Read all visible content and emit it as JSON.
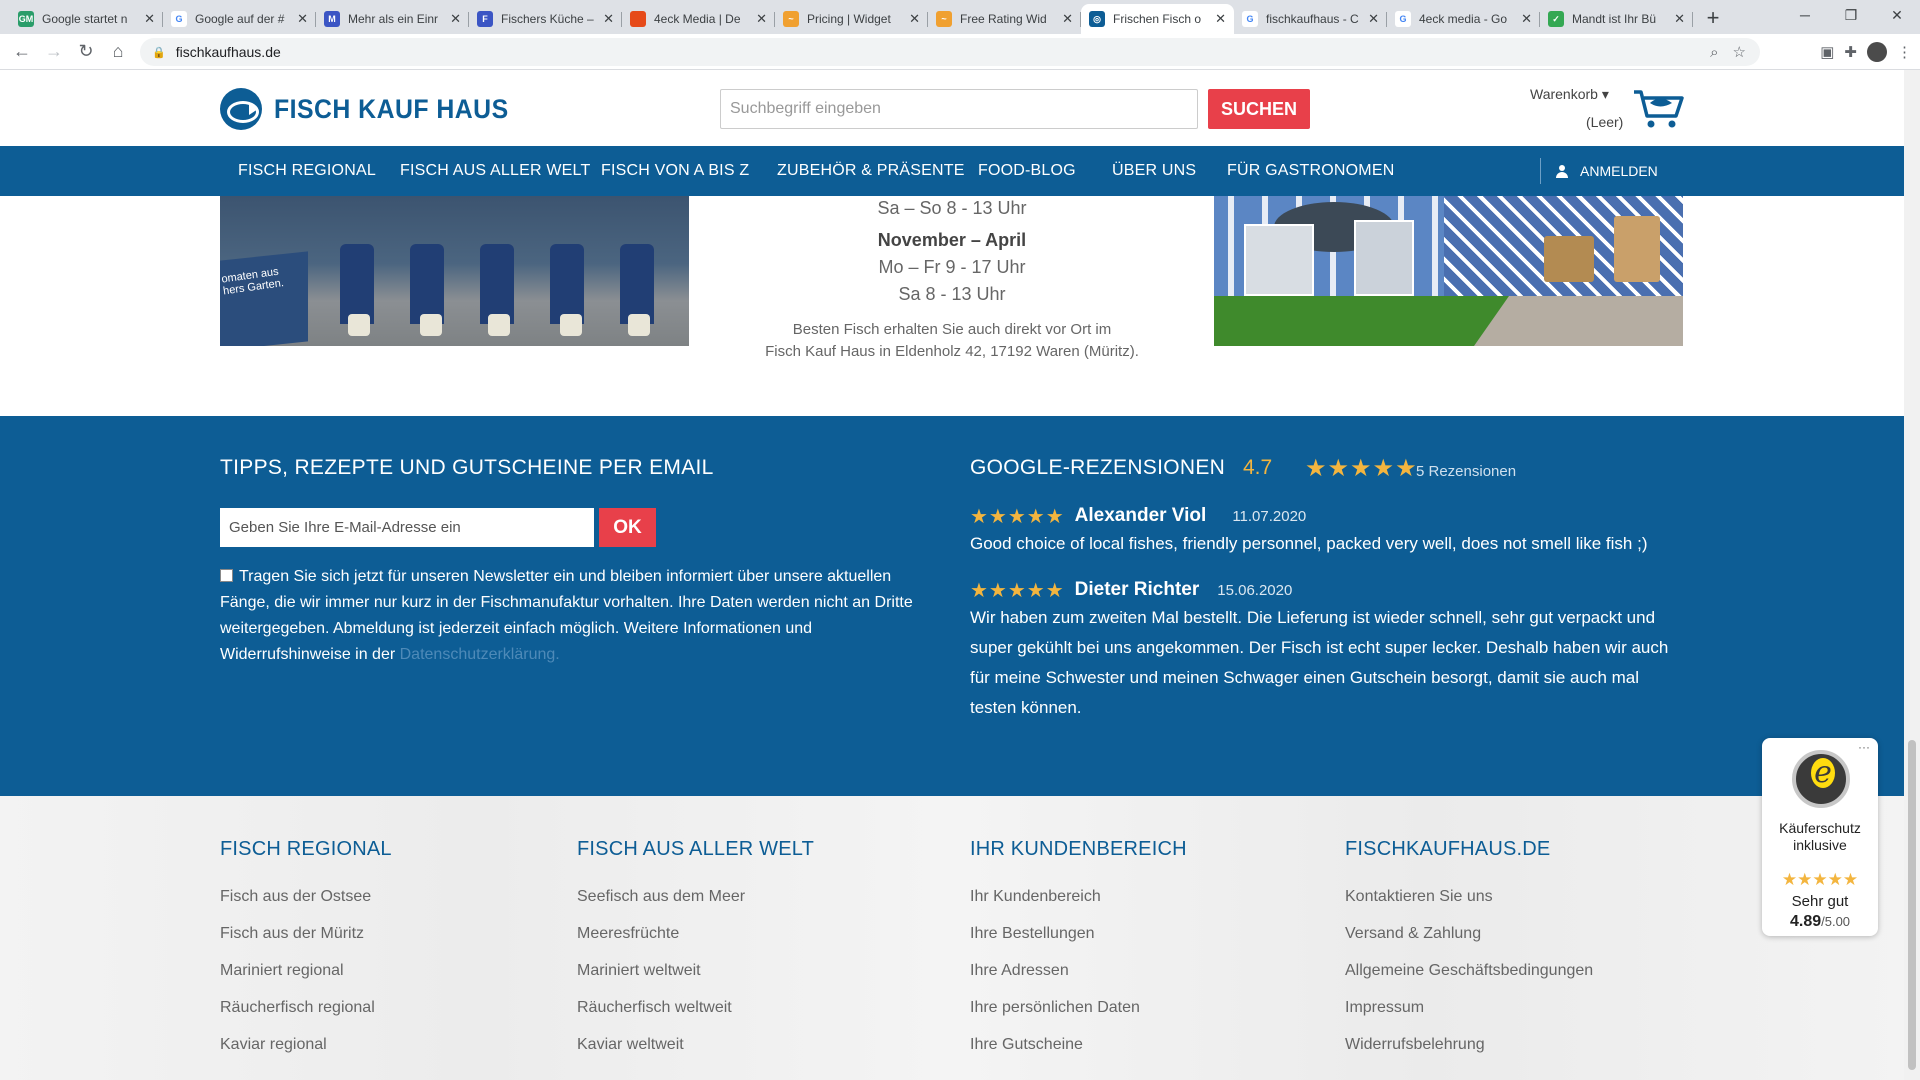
{
  "browser": {
    "tabs": [
      {
        "title": "Google startet n",
        "fav_color": "#2a9d6a",
        "fav_glyph": "GM"
      },
      {
        "title": "Google auf der #",
        "fav_color": "#ffffff",
        "fav_glyph": "G"
      },
      {
        "title": "Mehr als ein Einr",
        "fav_color": "#3b55c4",
        "fav_glyph": "M"
      },
      {
        "title": "Fischers Küche –",
        "fav_color": "#3b55c4",
        "fav_glyph": "F"
      },
      {
        "title": "4eck Media | De",
        "fav_color": "#e64a19",
        "fav_glyph": ""
      },
      {
        "title": "Pricing | Widget",
        "fav_color": "#f0a030",
        "fav_glyph": "~"
      },
      {
        "title": "Free Rating Wid",
        "fav_color": "#f0a030",
        "fav_glyph": "~"
      },
      {
        "title": "Frischen Fisch o",
        "fav_color": "#0d5d95",
        "fav_glyph": "◎"
      },
      {
        "title": "fischkaufhaus - C",
        "fav_color": "#ffffff",
        "fav_glyph": "G"
      },
      {
        "title": "4eck media - Go",
        "fav_color": "#ffffff",
        "fav_glyph": "G"
      },
      {
        "title": "Mandt ist Ihr Bü",
        "fav_color": "#34a853",
        "fav_glyph": "✓"
      }
    ],
    "active_tab": 7,
    "new_tab": "+",
    "url": "fischkaufhaus.de"
  },
  "header": {
    "logo_text": "FISCH KAUF HAUS",
    "search_placeholder": "Suchbegriff eingeben",
    "search_button": "SUCHEN",
    "cart_label": "Warenkorb ▾",
    "cart_status": "(Leer)"
  },
  "nav": {
    "items": [
      "FISCH REGIONAL",
      "FISCH AUS ALLER WELT",
      "FISCH VON A BIS Z",
      "ZUBEHÖR & PRÄSENTE",
      "FOOD-BLOG",
      "ÜBER UNS",
      "FÜR GASTRONOMEN"
    ],
    "login": "ANMELDEN"
  },
  "hours": {
    "line_top": "Sa – So   8 - 13 Uhr",
    "season": "November – April",
    "line_weekdays": "Mo – Fr   9 - 17 Uhr",
    "line_sat": "Sa   8 - 13 Uhr",
    "note_1": "Besten Fisch erhalten Sie auch direkt vor Ort im",
    "note_2": "Fisch Kauf Haus in Eldenholz 42,  17192 Waren (Müritz)."
  },
  "photo_left_sign": "omaten aus hers Garten.",
  "newsletter": {
    "title": "TIPPS, REZEPTE UND GUTSCHEINE PER EMAIL",
    "email_placeholder": "Geben Sie Ihre E-Mail-Adresse ein",
    "ok_button": "OK",
    "consent_text": "Tragen Sie sich jetzt für unseren Newsletter ein und bleiben informiert über unsere aktuellen Fänge, die wir immer nur kurz in der Fischmanufaktur vorhalten. Ihre Daten werden nicht an Dritte weitergegeben. Abmeldung ist jederzeit einfach möglich. Weitere Informationen und Widerrufshinweise in der ",
    "consent_link": "Datenschutzerklärung."
  },
  "google_reviews": {
    "title": "GOOGLE-REZENSIONEN",
    "rating": "4.7",
    "stars": "★★★★★",
    "count": "5 Rezensionen",
    "reviews": [
      {
        "stars": "★★★★★",
        "name": "Alexander Viol",
        "date": "11.07.2020",
        "text": "Good choice of local fishes, friendly personnel, packed very well, does not smell like fish ;)"
      },
      {
        "stars": "★★★★★",
        "name": "Dieter Richter",
        "date": "15.06.2020",
        "text": "Wir haben zum zweiten Mal bestellt. Die Lieferung ist wieder schnell, sehr gut verpackt und super gekühlt bei uns angekommen. Der Fisch ist echt super lecker. Deshalb haben wir auch für meine Schwester und meinen Schwager einen Gutschein besorgt, damit sie auch mal testen können."
      }
    ]
  },
  "footer": {
    "columns": [
      {
        "title": "FISCH REGIONAL",
        "links": [
          "Fisch aus der Ostsee",
          "Fisch aus der Müritz",
          "Mariniert regional",
          "Räucherfisch regional",
          "Kaviar regional"
        ]
      },
      {
        "title": "FISCH AUS ALLER WELT",
        "links": [
          "Seefisch aus dem Meer",
          "Meeresfrüchte",
          "Mariniert weltweit",
          "Räucherfisch weltweit",
          "Kaviar weltweit"
        ]
      },
      {
        "title": "IHR KUNDENBEREICH",
        "links": [
          "Ihr Kundenbereich",
          "Ihre Bestellungen",
          "Ihre Adressen",
          "Ihre persönlichen Daten",
          "Ihre Gutscheine"
        ]
      },
      {
        "title": "FISCHKAUFHAUS.DE",
        "links": [
          "Kontaktieren Sie uns",
          "Versand & Zahlung",
          "Allgemeine Geschäftsbedingungen",
          "Impressum",
          "Widerrufsbelehrung"
        ]
      }
    ]
  },
  "trusted_shops": {
    "dots": "···",
    "line1": "Käuferschutz",
    "line2": "inklusive",
    "stars": "★★★★★",
    "verdict": "Sehr gut",
    "score": "4.89",
    "score_max": "/5.00"
  },
  "colors": {
    "brand_blue": "#0d5d95",
    "accent_red": "#e8404a",
    "star_gold": "#f3b53f"
  }
}
